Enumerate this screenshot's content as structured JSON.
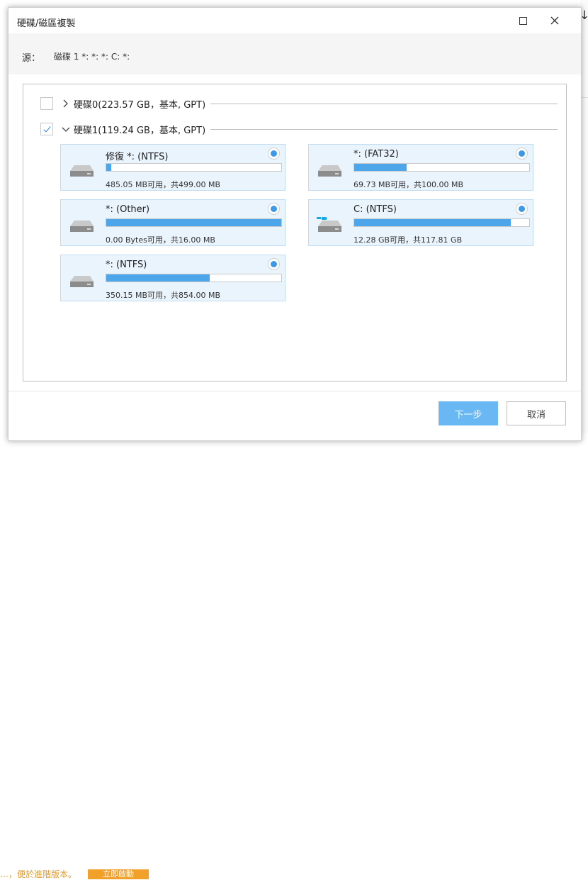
{
  "dialog": {
    "title": "硬碟/磁區複製",
    "source_label": "源：",
    "source_value": "磁碟 1 *: *: *: C: *:"
  },
  "disks": [
    {
      "label": "硬碟0(223.57 GB，基本, GPT)",
      "checked": false,
      "expanded": false
    },
    {
      "label": "硬碟1(119.24 GB，基本, GPT)",
      "checked": true,
      "expanded": true
    }
  ],
  "partitions": [
    {
      "name": "修復 *: (NTFS)",
      "info": "485.05 MB可用，共499.00 MB",
      "used_fraction": 0.03,
      "icon": "drive-icon",
      "selected": true
    },
    {
      "name": "*: (FAT32)",
      "info": "69.73 MB可用，共100.00 MB",
      "used_fraction": 0.3,
      "icon": "drive-icon",
      "selected": true
    },
    {
      "name": "*: (Other)",
      "info": "0.00 Bytes可用，共16.00 MB",
      "used_fraction": 1.0,
      "icon": "drive-icon",
      "selected": true
    },
    {
      "name": "C: (NTFS)",
      "info": "12.28 GB可用，共117.81 GB",
      "used_fraction": 0.896,
      "icon": "windows-drive-icon",
      "selected": true
    },
    {
      "name": "*: (NTFS)",
      "info": "350.15 MB可用，共854.00 MB",
      "used_fraction": 0.59,
      "icon": "drive-icon",
      "selected": true
    }
  ],
  "buttons": {
    "next": "下一步",
    "cancel": "取消"
  },
  "colors": {
    "accent": "#4ea6ea",
    "card_bg": "#eaf4fc",
    "next_button": "#69b7f3",
    "radio": "#3d98e6"
  },
  "background": {
    "bottom_text": "…，便於進階版本。",
    "bottom_button": "立即啟動"
  }
}
